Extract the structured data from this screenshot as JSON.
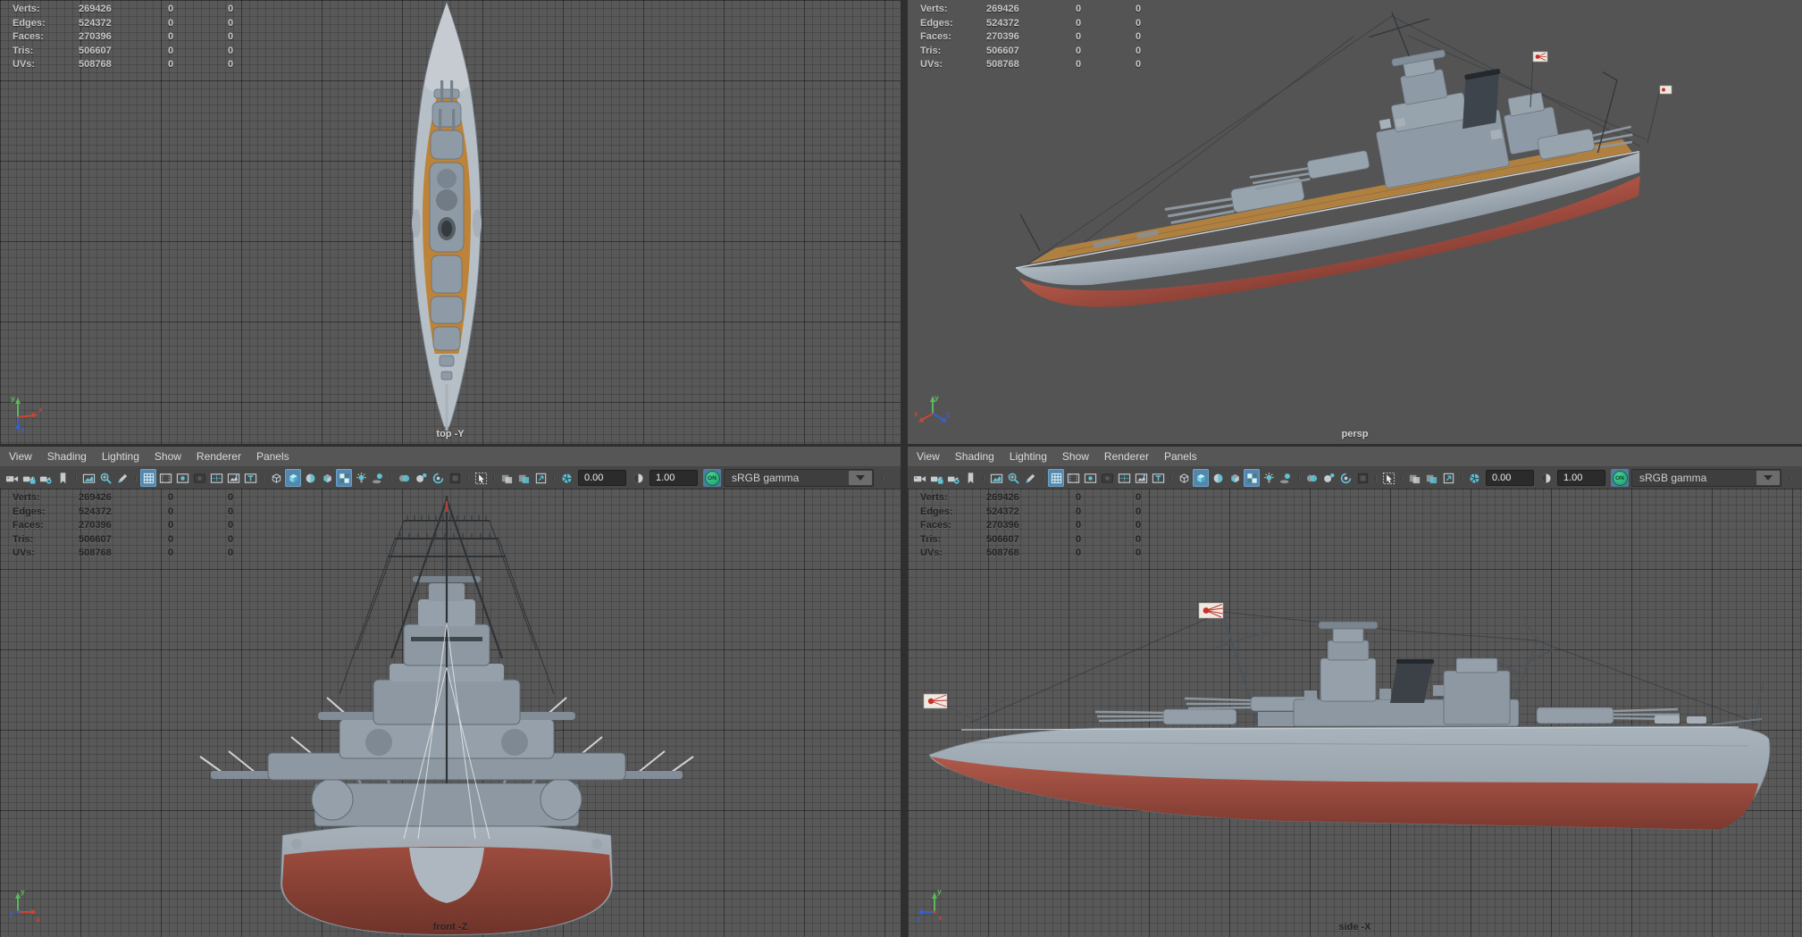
{
  "menus": [
    "View",
    "Shading",
    "Lighting",
    "Show",
    "Renderer",
    "Panels"
  ],
  "hud_rows": [
    {
      "label": "Verts:",
      "v1": "269426",
      "v2": "0",
      "v3": "0"
    },
    {
      "label": "Edges:",
      "v1": "524372",
      "v2": "0",
      "v3": "0"
    },
    {
      "label": "Faces:",
      "v1": "270396",
      "v2": "0",
      "v3": "0"
    },
    {
      "label": "Tris:",
      "v1": "506607",
      "v2": "0",
      "v3": "0"
    },
    {
      "label": "UVs:",
      "v1": "508768",
      "v2": "0",
      "v3": "0"
    }
  ],
  "toolbar": {
    "exposure": "0.00",
    "gamma": "1.00",
    "on_label": "ON",
    "colorspace": "sRGB gamma",
    "icons": [
      {
        "name": "select-camera-icon",
        "sym": "#sym-camera",
        "inter": "true"
      },
      {
        "name": "lock-camera-icon",
        "sym": "#sym-camera-lock",
        "inter": "true"
      },
      {
        "name": "camera-attributes-icon",
        "sym": "#sym-camera-attrs",
        "inter": "true"
      },
      {
        "name": "bookmark-icon",
        "sym": "#sym-bookmark",
        "inter": "true"
      },
      {
        "name": "toolbar-separator",
        "sym": "#sym-sep",
        "inter": "false"
      },
      {
        "name": "image-plane-icon",
        "sym": "#sym-image-plane",
        "inter": "true"
      },
      {
        "name": "pan-zoom-icon",
        "sym": "#sym-pan-zoom",
        "inter": "true"
      },
      {
        "name": "grease-pencil-icon",
        "sym": "#sym-pencil",
        "inter": "true"
      },
      {
        "name": "toolbar-separator",
        "sym": "#sym-sep",
        "inter": "false"
      },
      {
        "name": "grid-toggle-icon",
        "sym": "#sym-grid",
        "inter": "true",
        "active": "true"
      },
      {
        "name": "film-gate-icon",
        "sym": "#sym-film-gate",
        "inter": "true"
      },
      {
        "name": "resolution-gate-icon",
        "sym": "#sym-res-gate",
        "inter": "true"
      },
      {
        "name": "gate-mask-icon",
        "sym": "#sym-gate-mask",
        "inter": "true"
      },
      {
        "name": "field-chart-icon",
        "sym": "#sym-field-chart",
        "inter": "true"
      },
      {
        "name": "safe-action-icon",
        "sym": "#sym-safe-action",
        "inter": "true"
      },
      {
        "name": "safe-title-icon",
        "sym": "#sym-safe-title",
        "inter": "true"
      },
      {
        "name": "toolbar-separator",
        "sym": "#sym-sep",
        "inter": "false"
      },
      {
        "name": "wireframe-mode-icon",
        "sym": "#sym-wire-cube",
        "inter": "true"
      },
      {
        "name": "shaded-mode-icon",
        "sym": "#sym-shaded-cube",
        "inter": "true",
        "active": "true"
      },
      {
        "name": "default-material-icon",
        "sym": "#sym-default-mat",
        "inter": "true"
      },
      {
        "name": "textured-mode-icon",
        "sym": "#sym-tex-cube",
        "inter": "true"
      },
      {
        "name": "textured-checker-icon",
        "sym": "#sym-checker",
        "inter": "true",
        "active": "true"
      },
      {
        "name": "lights-icon",
        "sym": "#sym-light",
        "inter": "true"
      },
      {
        "name": "shadows-icon",
        "sym": "#sym-shadow",
        "inter": "true"
      },
      {
        "name": "toolbar-separator",
        "sym": "#sym-sep",
        "inter": "false"
      },
      {
        "name": "ambient-occlusion-icon",
        "sym": "#sym-ao",
        "inter": "true"
      },
      {
        "name": "depth-of-field-icon",
        "sym": "#sym-dof",
        "inter": "true"
      },
      {
        "name": "motion-blur-icon",
        "sym": "#sym-mblur",
        "inter": "true"
      },
      {
        "name": "multisample-icon",
        "sym": "#sym-msaa",
        "inter": "true"
      },
      {
        "name": "toolbar-separator",
        "sym": "#sym-sep",
        "inter": "false"
      },
      {
        "name": "isolate-select-icon",
        "sym": "#sym-isolate",
        "inter": "true"
      },
      {
        "name": "toolbar-separator",
        "sym": "#sym-sep",
        "inter": "false"
      },
      {
        "name": "xray-icon",
        "sym": "#sym-xray",
        "inter": "true"
      },
      {
        "name": "xray-active-icon",
        "sym": "#sym-xray2",
        "inter": "true"
      },
      {
        "name": "image-plane-toggle-icon",
        "sym": "#sym-iplane2",
        "inter": "true"
      },
      {
        "name": "toolbar-separator",
        "sym": "#sym-sep",
        "inter": "false"
      },
      {
        "name": "exposure-icon",
        "sym": "#sym-exposure",
        "inter": "true"
      }
    ]
  },
  "viewports": {
    "top_label": "top -Y",
    "persp_label": "persp",
    "front_label": "front -Z",
    "side_label": "side -X"
  },
  "axis": {
    "x": "x",
    "y": "y",
    "z": "z"
  },
  "colors": {
    "viewport_bg": "#545454",
    "grid_cell": "#585858",
    "menubar_bg": "#565656",
    "toolbar_bg": "#474747",
    "active_button_bg": "#5486ae",
    "accent_teal": "#5ec1d4",
    "hud_light_text": "#c6c6c6",
    "hud_dark_text": "#232323",
    "ship_deck_wood": "#b08040",
    "ship_hull_gray": "#9aa5ae",
    "ship_hull_red": "#a85243",
    "on_toggle_green": "#2fae77",
    "axis_x_red": "#cc4433",
    "axis_y_green": "#5cb85c",
    "axis_z_blue": "#3a5fcd"
  }
}
